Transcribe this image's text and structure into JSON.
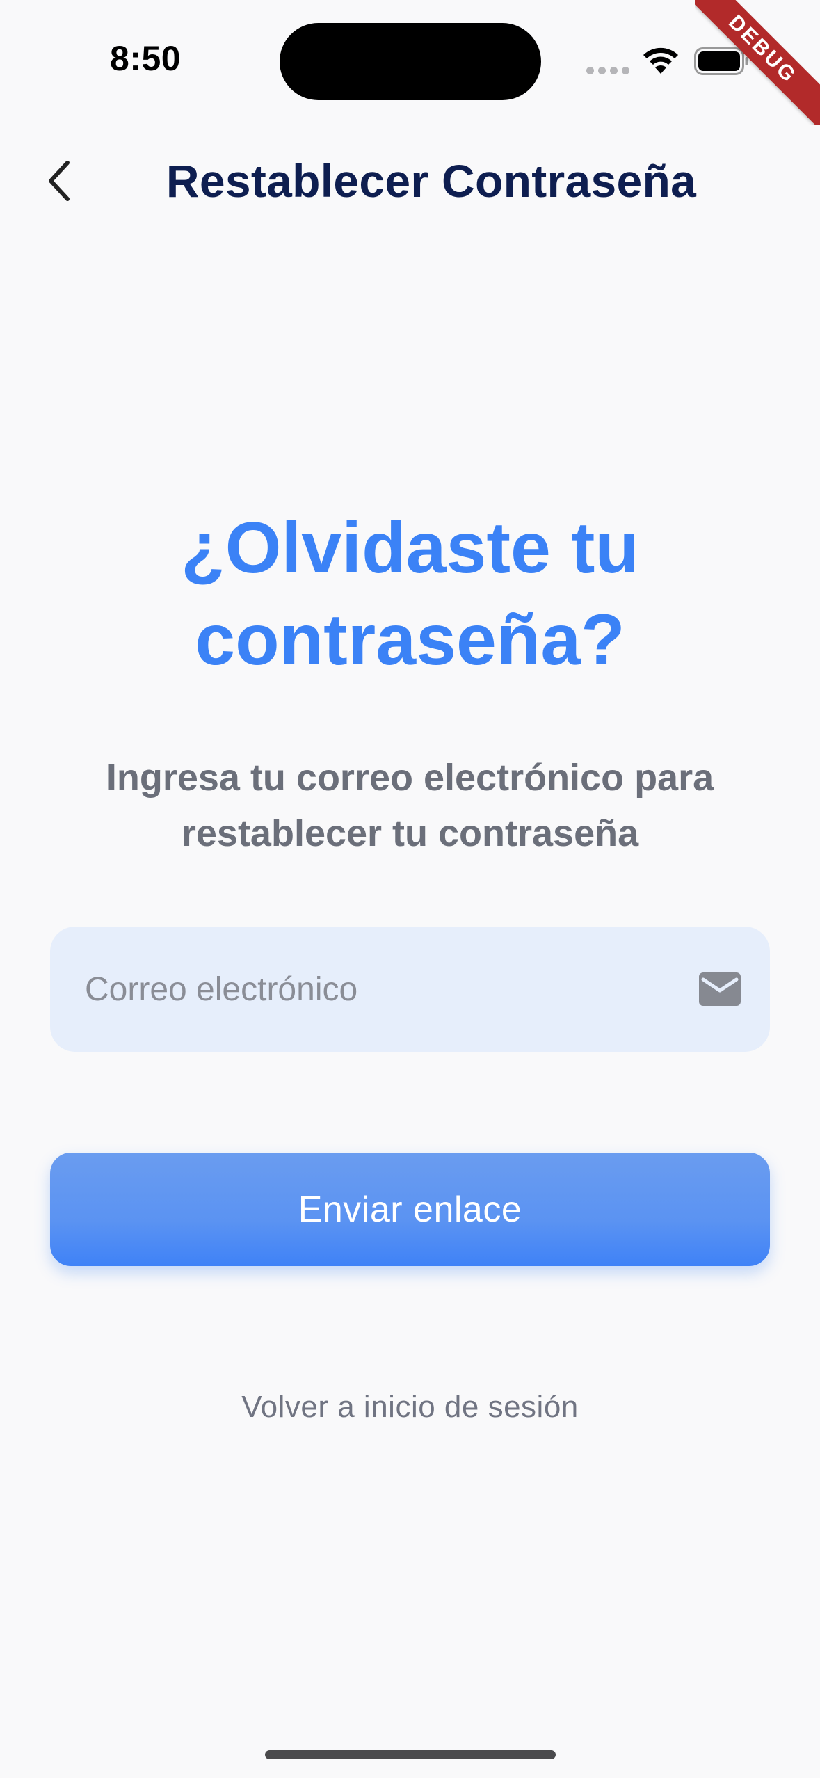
{
  "status_bar": {
    "time": "8:50",
    "icons": [
      "cellular-dots-icon",
      "wifi-icon",
      "battery-icon"
    ]
  },
  "debug_banner": "DEBUG",
  "app_bar": {
    "back_icon": "chevron-left-icon",
    "title": "Restablecer Contraseña"
  },
  "main": {
    "headline": "¿Olvidaste tu contraseña?",
    "subtitle": "Ingresa tu correo electrónico para restablecer tu contraseña",
    "email_field": {
      "placeholder": "Correo electrónico",
      "value": "",
      "icon": "mail-icon"
    },
    "send_button_label": "Enviar enlace",
    "back_to_login_label": "Volver a inicio de sesión"
  },
  "colors": {
    "accent": "#3b82f6",
    "title": "#0e1e50",
    "subtitle": "#6b6f7a",
    "field_bg": "#e6eefb",
    "background": "#f9f9fa"
  }
}
